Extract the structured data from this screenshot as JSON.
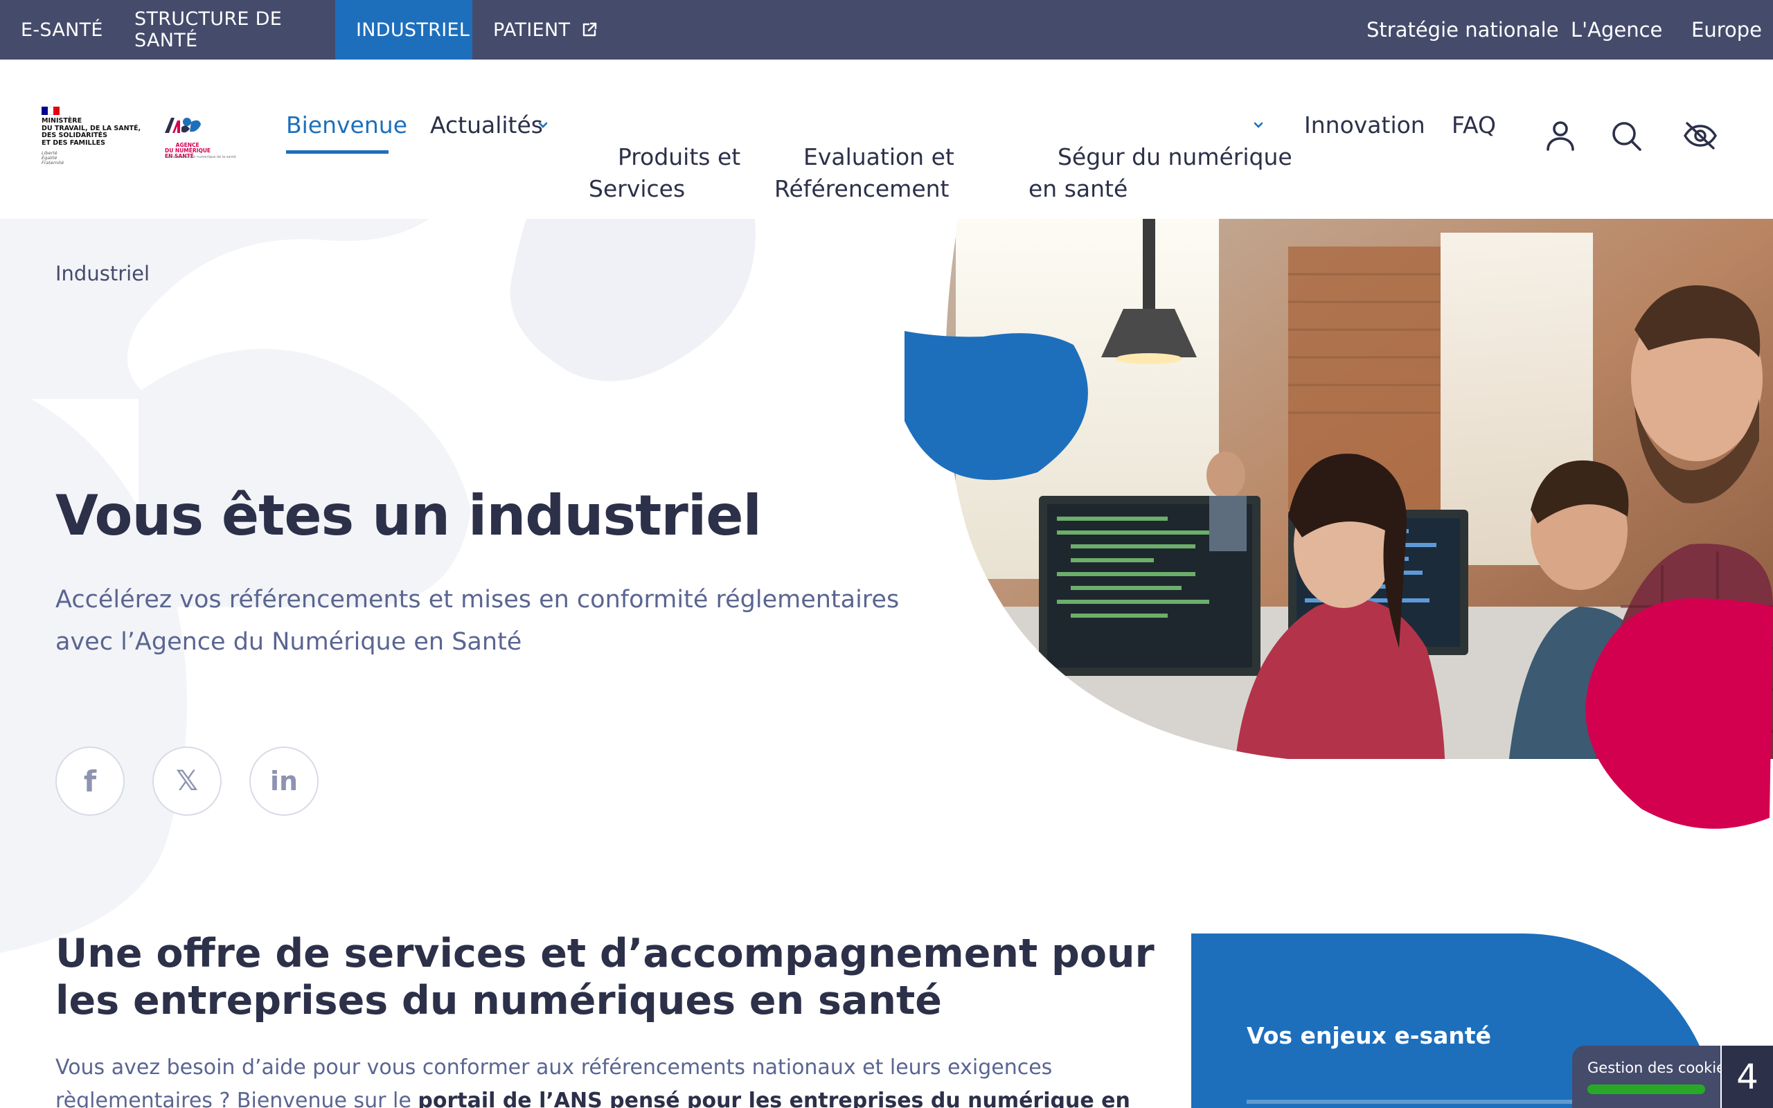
{
  "topbar": {
    "tabs": [
      "E-SANTÉ",
      "STRUCTURE DE SANTÉ",
      "INDUSTRIEL",
      "PATIENT"
    ],
    "active_tab": "INDUSTRIEL",
    "right_links": [
      "Stratégie nationale",
      "L'Agence",
      "Europe"
    ]
  },
  "logos": {
    "gov_text": "MINISTÈRE\nDU TRAVAIL, DE LA SANTÉ,\nDES SOLIDARITÉS\nET DES FAMILLES",
    "gov_motto": "Liberté\nÉgalité\nFraternité",
    "ans_text": "AGENCE\nDU NUMÉRIQUE\nEN SANTÉ",
    "ans_tagline": "La transformation numérique de la santé"
  },
  "nav": {
    "items": [
      {
        "label": "Bienvenue",
        "active": true
      },
      {
        "label": "Actualités",
        "has_dropdown": true
      },
      {
        "label": "Produits et\nServices"
      },
      {
        "label": "Evaluation et\nRéférencement"
      },
      {
        "label": "Ségur du numérique\nen santé",
        "has_dropdown": true
      },
      {
        "label": "Innovation"
      },
      {
        "label": "FAQ"
      }
    ],
    "icons": [
      "user-icon",
      "search-icon",
      "eye-slash-icon"
    ]
  },
  "hero": {
    "breadcrumb": "Industriel",
    "title": "Vous êtes un industriel",
    "subtitle": "Accélérez vos référencements et mises en conformité réglementaires avec l’Agence du Numérique en Santé",
    "social": [
      {
        "icon": "facebook-icon",
        "glyph": "f"
      },
      {
        "icon": "x-icon",
        "glyph": "𝕏"
      },
      {
        "icon": "linkedin-icon",
        "glyph": "in"
      }
    ]
  },
  "section": {
    "title": "Une offre de services et d’accompagnement pour les entreprises du numériques en santé",
    "text_before": "Vous avez besoin d’aide pour vous conformer aux référencements nationaux et leurs exigences règlementaires ? Bienvenue sur le ",
    "link": "portail de l’ANS pensé pour les entreprises du numérique en santé",
    "text_after": " !"
  },
  "card": {
    "title": "Vos enjeux e-santé"
  },
  "cookie": {
    "label": "Gestion des cookies",
    "count": "4"
  },
  "colors": {
    "topbar": "#454b6b",
    "accent_blue": "#1d6fbc",
    "accent_red": "#d3004f",
    "text_dark": "#2c3049",
    "text_muted": "#5a6591"
  }
}
